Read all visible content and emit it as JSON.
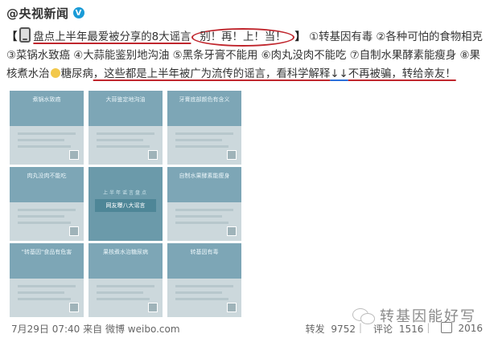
{
  "header": {
    "username": "@央视新闻",
    "verified_badge": "V"
  },
  "post": {
    "open_bracket": "【",
    "intro": "盘点上半年最爱被分享的8大谣言",
    "highlight": "别！再！上！当！",
    "close_bracket": "】",
    "rumor1": "①转基因有毒",
    "rumor2": "②各种可怕的食物相克",
    "rumor3": "③菜锅水致癌",
    "rumor4": "④大蒜能鉴别地沟油",
    "rumor5": "⑤黑条牙膏不能用",
    "rumor6": "⑥肉丸没肉不能吃",
    "rumor7": "⑦自制水果酵素能瘦身",
    "rumor8a": "⑧果",
    "rumor8b": "核煮水治",
    "rumor8c": "糖尿病",
    "conclusion": "，这些都是上半年被广为流传的谣言，看科学解释",
    "arrows": "↓↓",
    "ending": "不再被骗，转给亲友！"
  },
  "tiles": [
    {
      "title": "煮锅水致癌"
    },
    {
      "title": "大蒜鉴定地沟油"
    },
    {
      "title": "牙膏底部颜色有含义"
    },
    {
      "title": "肉丸没肉不能吃"
    },
    {
      "title": "网友曝八大谣言",
      "subtitle": "上半年谣言盘点"
    },
    {
      "title": "自制水果酵素能瘦身"
    },
    {
      "title": "\"转基因\"食品有危害"
    },
    {
      "title": "果核煮水治糖尿病"
    },
    {
      "title": "转基因有毒"
    }
  ],
  "watermark": {
    "text": "转基因能好写"
  },
  "footer": {
    "date": "7月29日 07:40",
    "source_prefix": "来自",
    "source": "微博 weibo.com",
    "repost_label": "转发",
    "repost_count": "9752",
    "comment_label": "评论",
    "comment_count": "1516",
    "like_count": "2016"
  }
}
